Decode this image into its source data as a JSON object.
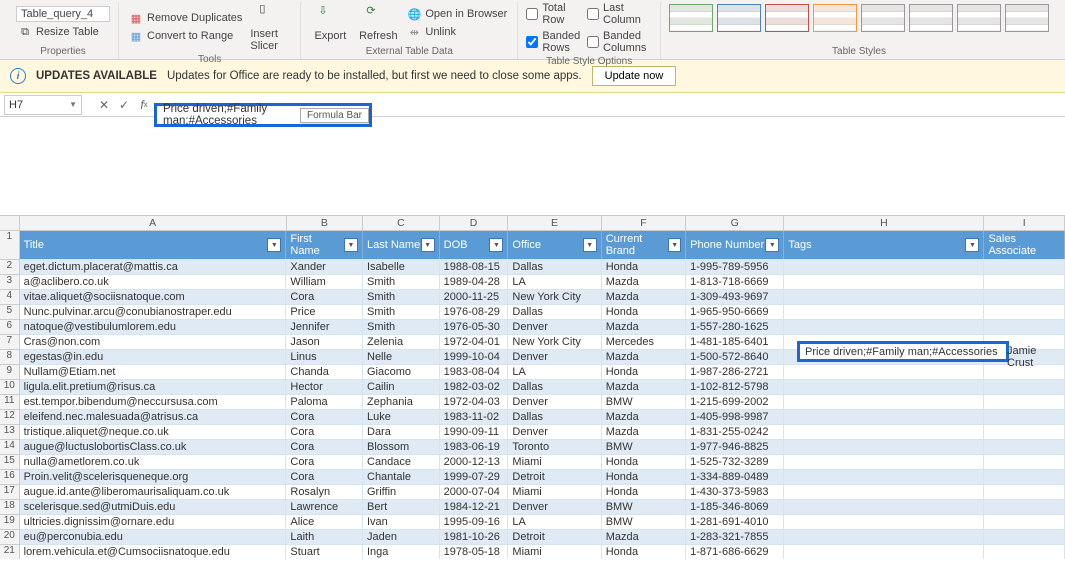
{
  "ribbon": {
    "tablename": "Table_query_4",
    "resize": "Resize Table",
    "properties": "Properties",
    "remove_dup": "Remove Duplicates",
    "convert": "Convert to Range",
    "slicer": "Insert Slicer",
    "tools": "Tools",
    "export": "Export",
    "refresh": "Refresh",
    "open_browser": "Open in Browser",
    "unlink": "Unlink",
    "external": "External Table Data",
    "total_row": "Total Row",
    "last_col": "Last Column",
    "banded_rows": "Banded Rows",
    "banded_cols": "Banded Columns",
    "style_options": "Table Style Options",
    "table_styles": "Table Styles"
  },
  "notify": {
    "title": "UPDATES AVAILABLE",
    "msg": "Updates for Office are ready to be installed, but first we need to close some apps.",
    "btn": "Update now"
  },
  "formula": {
    "cellref": "H7",
    "value": "Price driven;#Family man;#Accessories",
    "tooltip": "Formula Bar"
  },
  "colletters": [
    "A",
    "B",
    "C",
    "D",
    "E",
    "F",
    "G",
    "H",
    "I"
  ],
  "headers": [
    "Title",
    "First Name",
    "Last Name",
    "DOB",
    "Office",
    "Current Brand",
    "Phone Number",
    "Tags",
    "Sales Associate"
  ],
  "selected_row_index": 5,
  "selected_tags": "Price driven;#Family man;#Accessories",
  "selected_assoc": "Jamie Crust",
  "rows": [
    {
      "n": 2,
      "title": "eget.dictum.placerat@mattis.ca",
      "fn": "Xander",
      "ln": "Isabelle",
      "dob": "1988-08-15",
      "off": "Dallas",
      "brand": "Honda",
      "phone": "1-995-789-5956",
      "tags": ""
    },
    {
      "n": 3,
      "title": "a@aclibero.co.uk",
      "fn": "William",
      "ln": "Smith",
      "dob": "1989-04-28",
      "off": "LA",
      "brand": "Mazda",
      "phone": "1-813-718-6669",
      "tags": ""
    },
    {
      "n": 4,
      "title": "vitae.aliquet@sociisnatoque.com",
      "fn": "Cora",
      "ln": "Smith",
      "dob": "2000-11-25",
      "off": "New York City",
      "brand": "Mazda",
      "phone": "1-309-493-9697",
      "tags": ""
    },
    {
      "n": 5,
      "title": "Nunc.pulvinar.arcu@conubianostraper.edu",
      "fn": "Price",
      "ln": "Smith",
      "dob": "1976-08-29",
      "off": "Dallas",
      "brand": "Honda",
      "phone": "1-965-950-6669",
      "tags": ""
    },
    {
      "n": 6,
      "title": "natoque@vestibulumlorem.edu",
      "fn": "Jennifer",
      "ln": "Smith",
      "dob": "1976-05-30",
      "off": "Denver",
      "brand": "Mazda",
      "phone": "1-557-280-1625",
      "tags": ""
    },
    {
      "n": 7,
      "title": "Cras@non.com",
      "fn": "Jason",
      "ln": "Zelenia",
      "dob": "1972-04-01",
      "off": "New York City",
      "brand": "Mercedes",
      "phone": "1-481-185-6401",
      "tags": ""
    },
    {
      "n": 8,
      "title": "egestas@in.edu",
      "fn": "Linus",
      "ln": "Nelle",
      "dob": "1999-10-04",
      "off": "Denver",
      "brand": "Mazda",
      "phone": "1-500-572-8640",
      "tags": ""
    },
    {
      "n": 9,
      "title": "Nullam@Etiam.net",
      "fn": "Chanda",
      "ln": "Giacomo",
      "dob": "1983-08-04",
      "off": "LA",
      "brand": "Honda",
      "phone": "1-987-286-2721",
      "tags": ""
    },
    {
      "n": 10,
      "title": "ligula.elit.pretium@risus.ca",
      "fn": "Hector",
      "ln": "Cailin",
      "dob": "1982-03-02",
      "off": "Dallas",
      "brand": "Mazda",
      "phone": "1-102-812-5798",
      "tags": ""
    },
    {
      "n": 11,
      "title": "est.tempor.bibendum@neccursusa.com",
      "fn": "Paloma",
      "ln": "Zephania",
      "dob": "1972-04-03",
      "off": "Denver",
      "brand": "BMW",
      "phone": "1-215-699-2002",
      "tags": ""
    },
    {
      "n": 12,
      "title": "eleifend.nec.malesuada@atrisus.ca",
      "fn": "Cora",
      "ln": "Luke",
      "dob": "1983-11-02",
      "off": "Dallas",
      "brand": "Mazda",
      "phone": "1-405-998-9987",
      "tags": ""
    },
    {
      "n": 13,
      "title": "tristique.aliquet@neque.co.uk",
      "fn": "Cora",
      "ln": "Dara",
      "dob": "1990-09-11",
      "off": "Denver",
      "brand": "Mazda",
      "phone": "1-831-255-0242",
      "tags": ""
    },
    {
      "n": 14,
      "title": "augue@luctuslobortisClass.co.uk",
      "fn": "Cora",
      "ln": "Blossom",
      "dob": "1983-06-19",
      "off": "Toronto",
      "brand": "BMW",
      "phone": "1-977-946-8825",
      "tags": ""
    },
    {
      "n": 15,
      "title": "nulla@ametlorem.co.uk",
      "fn": "Cora",
      "ln": "Candace",
      "dob": "2000-12-13",
      "off": "Miami",
      "brand": "Honda",
      "phone": "1-525-732-3289",
      "tags": ""
    },
    {
      "n": 16,
      "title": "Proin.velit@scelerisqueneque.org",
      "fn": "Cora",
      "ln": "Chantale",
      "dob": "1999-07-29",
      "off": "Detroit",
      "brand": "Honda",
      "phone": "1-334-889-0489",
      "tags": ""
    },
    {
      "n": 17,
      "title": "augue.id.ante@liberomaurisaliquam.co.uk",
      "fn": "Rosalyn",
      "ln": "Griffin",
      "dob": "2000-07-04",
      "off": "Miami",
      "brand": "Honda",
      "phone": "1-430-373-5983",
      "tags": ""
    },
    {
      "n": 18,
      "title": "scelerisque.sed@utmiDuis.edu",
      "fn": "Lawrence",
      "ln": "Bert",
      "dob": "1984-12-21",
      "off": "Denver",
      "brand": "BMW",
      "phone": "1-185-346-8069",
      "tags": ""
    },
    {
      "n": 19,
      "title": "ultricies.dignissim@ornare.edu",
      "fn": "Alice",
      "ln": "Ivan",
      "dob": "1995-09-16",
      "off": "LA",
      "brand": "BMW",
      "phone": "1-281-691-4010",
      "tags": ""
    },
    {
      "n": 20,
      "title": "eu@perconubia.edu",
      "fn": "Laith",
      "ln": "Jaden",
      "dob": "1981-10-26",
      "off": "Detroit",
      "brand": "Mazda",
      "phone": "1-283-321-7855",
      "tags": ""
    },
    {
      "n": 21,
      "title": "lorem.vehicula.et@Cumsociisnatoque.edu",
      "fn": "Stuart",
      "ln": "Inga",
      "dob": "1978-05-18",
      "off": "Miami",
      "brand": "Honda",
      "phone": "1-871-686-6629",
      "tags": ""
    }
  ],
  "style_colors": [
    "#6fa86f",
    "#4f81bd",
    "#c0504d",
    "#f79646",
    "#999999",
    "#999999",
    "#999999",
    "#999999"
  ]
}
